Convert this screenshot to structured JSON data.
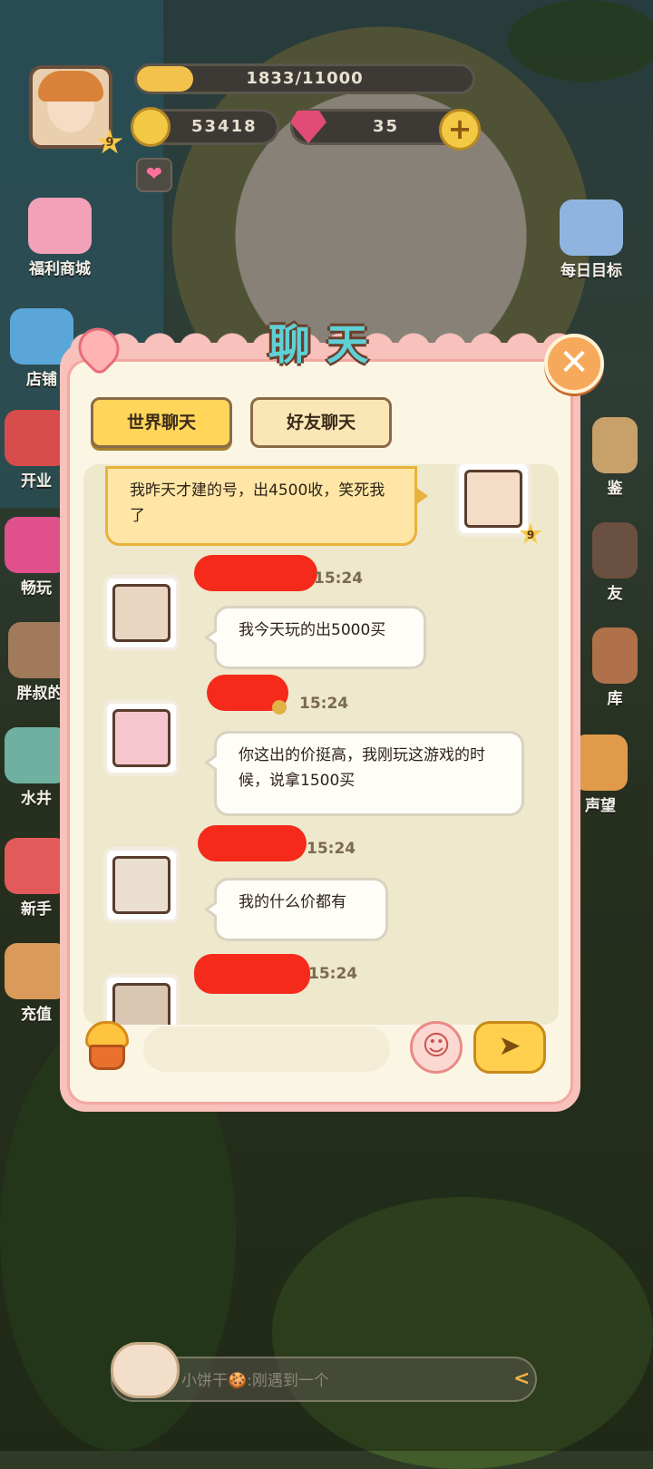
{
  "hud": {
    "level": "9",
    "xp_text": "1833/11000",
    "xp_progress": 0.1666,
    "coins": "53418",
    "gems": "35",
    "plus_symbol": "+",
    "heart_symbol": "❤"
  },
  "sidebar_left": [
    {
      "label": "福利商城",
      "icon": "cake-shop-icon"
    },
    {
      "label": "店铺",
      "icon": "video-shop-icon"
    },
    {
      "label": "开业",
      "icon": "gift-icon"
    },
    {
      "label": "畅玩",
      "icon": "gift-box-icon"
    },
    {
      "label": "胖叔的",
      "icon": "chef-icon"
    },
    {
      "label": "水井",
      "icon": "well-icon"
    },
    {
      "label": "新手",
      "icon": "newbie-icon"
    },
    {
      "label": "充值",
      "icon": "recharge-icon"
    }
  ],
  "sidebar_right": [
    {
      "label": "每日目标",
      "icon": "calendar-icon"
    },
    {
      "label": "鉴",
      "icon": "collection-icon"
    },
    {
      "label": "友",
      "icon": "friends-icon"
    },
    {
      "label": "库",
      "icon": "storage-icon"
    },
    {
      "label": "声望",
      "icon": "reputation-icon"
    }
  ],
  "chat_panel": {
    "title": "聊天",
    "close_symbol": "✕",
    "tabs": [
      {
        "label": "世界聊天",
        "active": true
      },
      {
        "label": "好友聊天",
        "active": false
      }
    ],
    "messages": [
      {
        "mine": true,
        "text": "我昨天才建的号，出4500收，笑死我了",
        "level": "9"
      },
      {
        "mine": false,
        "time": "15:24",
        "text": "我今天玩的出5000买"
      },
      {
        "mine": false,
        "time": "15:24",
        "text": "你这出的价挺高，我刚玩这游戏的时候，说拿1500买"
      },
      {
        "mine": false,
        "time": "15:24",
        "text": "我的什么价都有"
      },
      {
        "mine": false,
        "time": "15:24",
        "text": ""
      }
    ],
    "input_placeholder": "",
    "emoji_symbol": "☺",
    "send_symbol": "➤"
  },
  "bottom_bar": {
    "text": "小饼干🍪:刚遇到一个",
    "arrow": "<"
  }
}
